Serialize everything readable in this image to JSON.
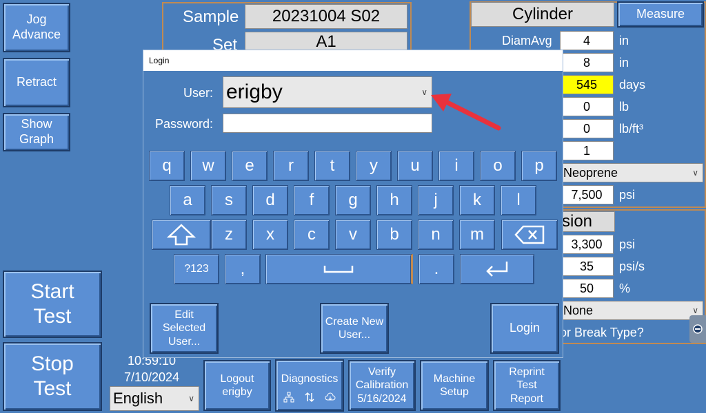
{
  "left_buttons": {
    "jog_advance": "Jog\nAdvance",
    "retract": "Retract",
    "show_graph": "Show\nGraph",
    "start_test": "Start\nTest",
    "stop_test": "Stop\nTest"
  },
  "sample_panel": {
    "sample_label": "Sample",
    "sample_value": "20231004 S02",
    "set_label": "Set",
    "set_value": "A1"
  },
  "cylinder_panel": {
    "title": "Cylinder",
    "measure_label": "Measure",
    "diam_label": "DiamAvg",
    "rows": [
      {
        "value": "4",
        "unit": "in"
      },
      {
        "value": "8",
        "unit": "in"
      },
      {
        "value": "545",
        "unit": "days"
      },
      {
        "value": "0",
        "unit": "lb"
      },
      {
        "value": "0",
        "unit": "lb/ft³"
      },
      {
        "value": "1",
        "unit": ""
      }
    ],
    "cap_select": "Neoprene",
    "strength_value": "7,500",
    "strength_unit": "psi"
  },
  "compression_panel": {
    "title_fragment": "sion",
    "rows": [
      {
        "value": "3,300",
        "unit": "psi"
      },
      {
        "value": "35",
        "unit": "psi/s"
      },
      {
        "value": "50",
        "unit": "%"
      }
    ],
    "break_select": "None",
    "break_question": "or Break Type?"
  },
  "clock": {
    "time": "10:59:10",
    "date": "7/10/2024"
  },
  "language_select": "English",
  "bottom_buttons": {
    "logout": "Logout\nerigby",
    "diagnostics": "Diagnostics",
    "verify": "Verify\nCalibration\n5/16/2024",
    "machine_setup": "Machine\nSetup",
    "reprint": "Reprint\nTest\nReport"
  },
  "login_dialog": {
    "title": "Login",
    "user_label": "User:",
    "user_value": "erigby",
    "password_label": "Password:",
    "keys_row1": [
      "q",
      "w",
      "e",
      "r",
      "t",
      "y",
      "u",
      "i",
      "o",
      "p"
    ],
    "keys_row2": [
      "a",
      "s",
      "d",
      "f",
      "g",
      "h",
      "j",
      "k",
      "l"
    ],
    "keys_row3": [
      "z",
      "x",
      "c",
      "v",
      "b",
      "n",
      "m"
    ],
    "key_123": "?123",
    "key_comma": ",",
    "key_period": ".",
    "edit_user": "Edit\nSelected\nUser...",
    "create_user": "Create New\nUser...",
    "login": "Login"
  },
  "colors": {
    "background": "#4a7ebb",
    "button": "#5b8fd4",
    "highlight_field": "#ffff00",
    "arrow": "#e8323c"
  }
}
